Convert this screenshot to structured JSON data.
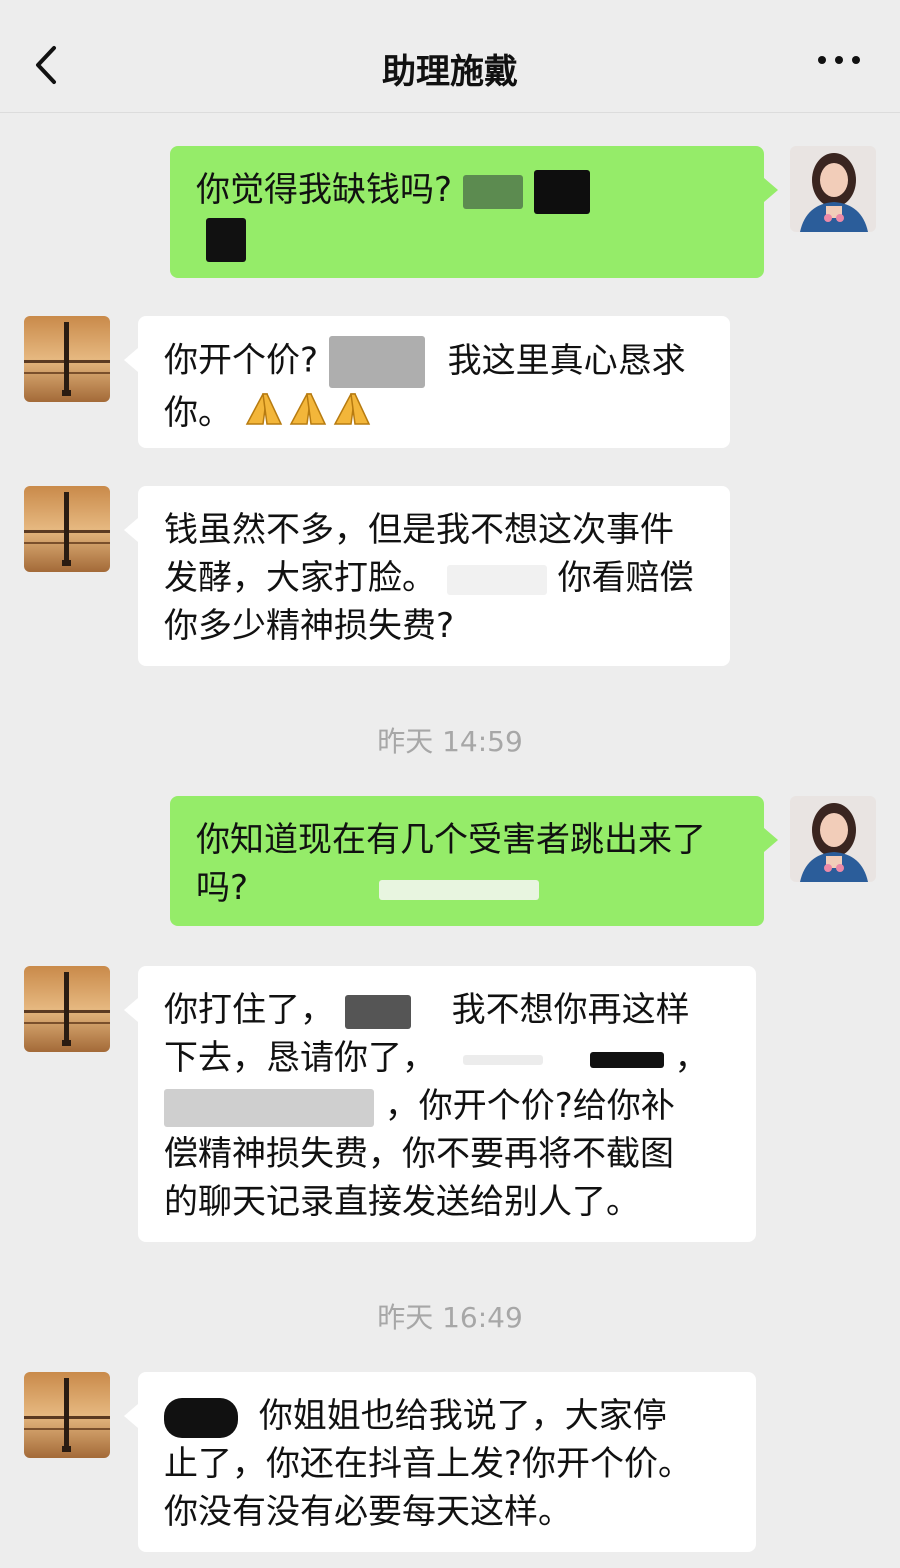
{
  "header": {
    "title": "助理施戴"
  },
  "messages": [
    {
      "side": "out",
      "lines": [
        "你觉得我缺钱吗?"
      ]
    },
    {
      "side": "in",
      "line1_a": "你开个价?",
      "line1_b": "我这里真心恳求",
      "line2": "你。",
      "emoji": "🙏🙏🙏"
    },
    {
      "side": "in",
      "line1": "钱虽然不多，但是我不想这次事件",
      "line2_a": "发酵，大家打脸。",
      "line2_b": "你看赔偿",
      "line3": "你多少精神损失费?"
    },
    {
      "side": "out",
      "line1": "你知道现在有几个受害者跳出来了",
      "line2": "吗?"
    },
    {
      "side": "in",
      "line1_a": "你打住了，",
      "line1_b": "我不想你再这样",
      "line2_a": "下去，恳请你了，",
      "line2_b": "，",
      "line3_b": "，你开个价?给你补",
      "line4": "偿精神损失费，你不要再将不截图",
      "line5": "的聊天记录直接发送给别人了。"
    },
    {
      "side": "in",
      "line1_b": "你姐姐也给我说了，大家停",
      "line2": "止了，你还在抖音上发?你开个价。",
      "line3": "你没有没有必要每天这样。"
    }
  ],
  "timestamps": [
    "昨天 14:59",
    "昨天 16:49"
  ],
  "colors": {
    "background": "#ededed",
    "outgoing_bubble": "#95ec69",
    "incoming_bubble": "#ffffff",
    "timestamp": "#a7a7a7"
  },
  "icons": [
    "back-chevron-icon",
    "more-dots-icon",
    "avatar-sunset-pole",
    "avatar-woman-photo",
    "praying-hands-emoji"
  ]
}
